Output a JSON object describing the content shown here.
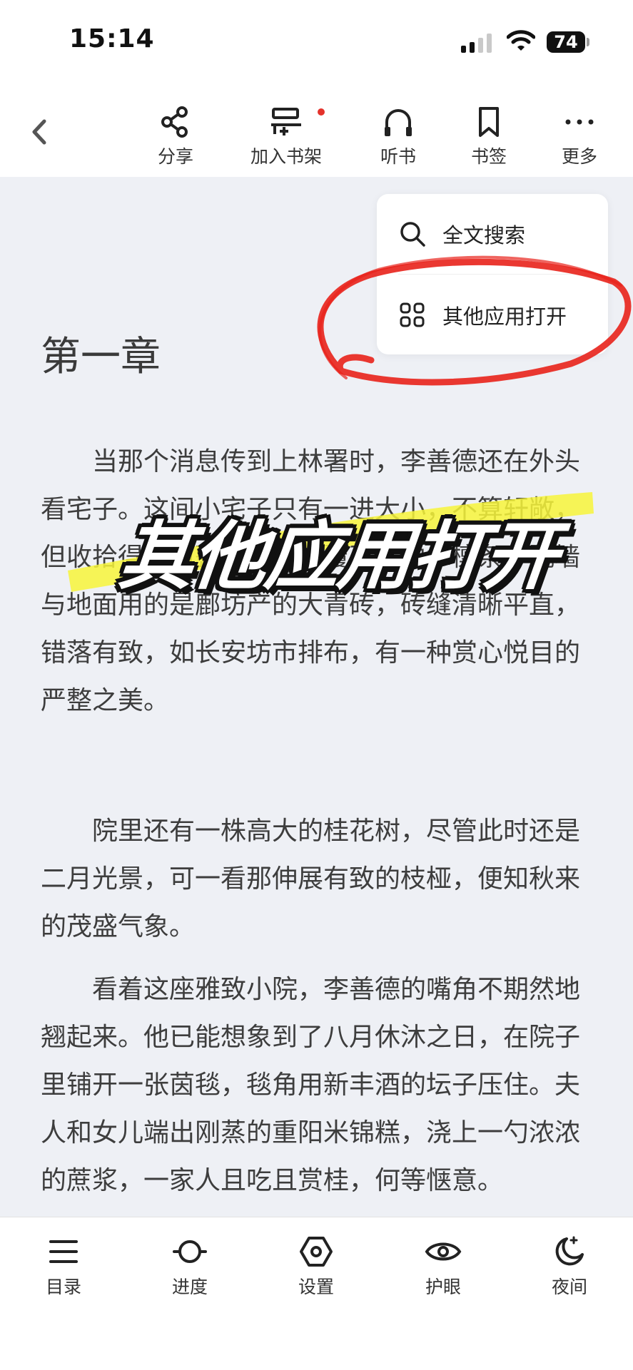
{
  "status_bar": {
    "time": "15:14",
    "battery": "74"
  },
  "toolbar": {
    "back_icon": "chevron-left-icon",
    "items": [
      {
        "label": "分享",
        "icon": "share-icon"
      },
      {
        "label": "加入书架",
        "icon": "add-to-shelf-icon",
        "badge": true
      },
      {
        "label": "听书",
        "icon": "headphones-icon"
      },
      {
        "label": "书签",
        "icon": "bookmark-icon"
      },
      {
        "label": "更多",
        "icon": "more-icon"
      }
    ]
  },
  "dropdown_menu": {
    "items": [
      {
        "label": "全文搜索",
        "icon": "search-icon"
      },
      {
        "label": "其他应用打开",
        "icon": "apps-grid-icon"
      }
    ]
  },
  "chapter": {
    "title": "第一章",
    "paragraphs": [
      "当那个消息传到上林署时，李善德还在外头看宅子。这间小宅子只有一进大小，不算轩敞，但收拾得颇为整洁。鱼鳞覆瓦，柏木檩条，院墙与地面用的是鄜坊产的大青砖，砖缝清晰平直，错落有致，如长安坊市排布，有一种赏心悦目的严整之美。",
      "院里还有一株高大的桂花树，尽管此时还是二月光景，可一看那伸展有致的枝桠，便知秋来的茂盛气象。",
      "看着这座雅致小院，李善德的嘴角不期然地翘起来。他已能想象到了八月休沐之日，在院子里铺开一张茵毯，毯角用新丰酒的坛子压住。夫人和女儿端出刚蒸的重阳米锦糕，浇上一勺浓浓的蔗浆，一家人且吃且赏桂，何等惬意。"
    ]
  },
  "overlay": {
    "caption": "其他应用打开",
    "annotation_color": "#e8221b",
    "highlight_color": "#f7f53a"
  },
  "bottom_nav": {
    "items": [
      {
        "label": "目录",
        "icon": "menu-list-icon"
      },
      {
        "label": "进度",
        "icon": "progress-icon"
      },
      {
        "label": "设置",
        "icon": "settings-hexagon-icon"
      },
      {
        "label": "护眼",
        "icon": "eye-icon"
      },
      {
        "label": "夜间",
        "icon": "night-mode-icon"
      }
    ]
  }
}
